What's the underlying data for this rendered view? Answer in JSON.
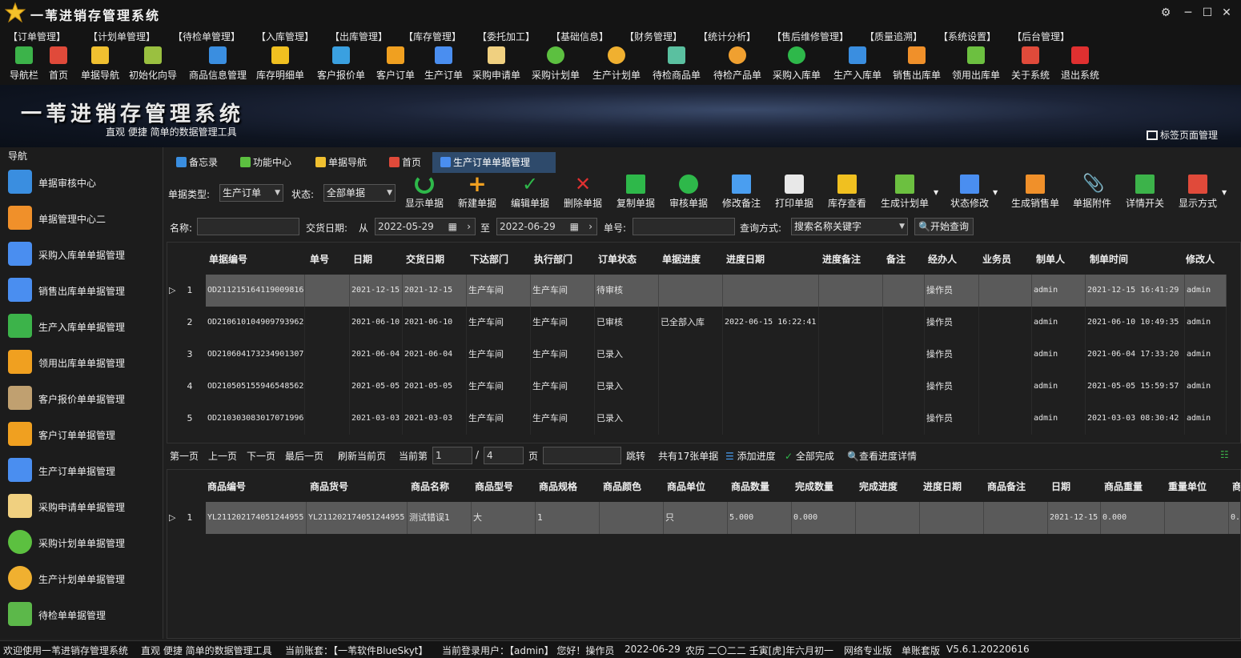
{
  "app": {
    "title": "一苇进销存管理系统"
  },
  "menu": [
    "【订单管理】",
    "【计划单管理】",
    "【待检单管理】",
    "【入库管理】",
    "【出库管理】",
    "【库存管理】",
    "【委托加工】",
    "【基础信息】",
    "【财务管理】",
    "【统计分析】",
    "【售后维修管理】",
    "【质量追溯】",
    "【系统设置】",
    "【后台管理】"
  ],
  "toolbar": [
    {
      "label": "导航栏",
      "color": "#3cb34a",
      "icon": "menu-icon"
    },
    {
      "label": "首页",
      "color": "#e04a3a",
      "icon": "home-icon"
    },
    {
      "label": "单据导航",
      "color": "#f0c030",
      "icon": "pen-icon"
    },
    {
      "label": "初始化向导",
      "color": "#9ac040",
      "icon": "wand-icon"
    },
    {
      "label": "商品信息管理",
      "color": "#3a8ee0",
      "icon": "cubes-icon"
    },
    {
      "label": "库存明细单",
      "color": "#f0c020",
      "icon": "warning-icon"
    },
    {
      "label": "客户报价单",
      "color": "#3aa0e0",
      "icon": "tag-icon"
    },
    {
      "label": "客户订单",
      "color": "#f0a020",
      "icon": "doc-icon"
    },
    {
      "label": "生产订单",
      "color": "#4a8ef0",
      "icon": "doc-icon"
    },
    {
      "label": "采购申请单",
      "color": "#f0d080",
      "icon": "mail-icon"
    },
    {
      "label": "采购计划单",
      "color": "#5cc040",
      "icon": "chat-icon"
    },
    {
      "label": "生产计划单",
      "color": "#f0b030",
      "icon": "chat-icon"
    },
    {
      "label": "待检商品单",
      "color": "#5ac0a0",
      "icon": "flask-icon"
    },
    {
      "label": "待检产品单",
      "color": "#f0a030",
      "icon": "flask-icon"
    },
    {
      "label": "采购入库单",
      "color": "#2eb84a",
      "icon": "plus-icon"
    },
    {
      "label": "生产入库单",
      "color": "#3a8ee0",
      "icon": "cart-icon"
    },
    {
      "label": "销售出库单",
      "color": "#f0902a",
      "icon": "transfer-icon"
    },
    {
      "label": "领用出库单",
      "color": "#6cc040",
      "icon": "download-icon"
    },
    {
      "label": "关于系统",
      "color": "#e04a3a",
      "icon": "home-icon"
    },
    {
      "label": "退出系统",
      "color": "#e03030",
      "icon": "exit-icon"
    }
  ],
  "banner": {
    "title": "一苇进销存管理系统",
    "subtitle": "直观 便捷 简单的数据管理工具",
    "tab_manage": "标签页面管理"
  },
  "nav": {
    "title": "导航",
    "items": [
      {
        "label": "单据审核中心",
        "color": "#3a8ee0"
      },
      {
        "label": "单据管理中心二",
        "color": "#f0902a"
      },
      {
        "label": "采购入库单单据管理",
        "color": "#4a8ef0"
      },
      {
        "label": "销售出库单单据管理",
        "color": "#4a8ef0"
      },
      {
        "label": "生产入库单单据管理",
        "color": "#3cb34a"
      },
      {
        "label": "领用出库单单据管理",
        "color": "#f0a020"
      },
      {
        "label": "客户报价单单据管理",
        "color": "#c0a070"
      },
      {
        "label": "客户订单单据管理",
        "color": "#f0a020"
      },
      {
        "label": "生产订单单据管理",
        "color": "#4a8ef0"
      },
      {
        "label": "采购申请单单据管理",
        "color": "#f0d080"
      },
      {
        "label": "采购计划单单据管理",
        "color": "#5cc040"
      },
      {
        "label": "生产计划单单据管理",
        "color": "#f0b030"
      },
      {
        "label": "待检单单据管理",
        "color": "#5cb84a"
      }
    ]
  },
  "tabs": [
    {
      "label": "备忘录",
      "color": "#3a8ee0"
    },
    {
      "label": "功能中心",
      "color": "#5cc040"
    },
    {
      "label": "单据导航",
      "color": "#f0c030"
    },
    {
      "label": "首页",
      "color": "#e04a3a"
    },
    {
      "label": "生产订单单据管理",
      "color": "#4a8ef0"
    }
  ],
  "filter": {
    "type_label": "单据类型:",
    "type_value": "生产订单",
    "status_label": "状态:",
    "status_value": "全部单据",
    "actions": [
      {
        "label": "显示单据",
        "color": "#2eb84a"
      },
      {
        "label": "新建单据",
        "color": "#f0a020"
      },
      {
        "label": "编辑单据",
        "color": "#2eb84a"
      },
      {
        "label": "删除单据",
        "color": "#e03030"
      },
      {
        "label": "复制单据",
        "color": "#2eb84a"
      },
      {
        "label": "审核单据",
        "color": "#2eb84a"
      },
      {
        "label": "修改备注",
        "color": "#4a9ef0"
      },
      {
        "label": "打印单据",
        "color": "#e8e8e8"
      },
      {
        "label": "库存查看",
        "color": "#f0c020"
      },
      {
        "label": "生成计划单",
        "color": "#6cc040"
      },
      {
        "label": "状态修改",
        "color": "#4a8ef0"
      },
      {
        "label": "生成销售单",
        "color": "#f0902a"
      },
      {
        "label": "单据附件",
        "color": "#40c0a0"
      },
      {
        "label": "详情开关",
        "color": "#3cb34a"
      },
      {
        "label": "显示方式",
        "color": "#e04a3a"
      }
    ]
  },
  "search": {
    "name_label": "名称:",
    "name_value": "",
    "date_label": "交货日期:",
    "from_label": "从",
    "from_value": "2022-05-29",
    "to_label": "至",
    "to_value": "2022-06-29",
    "no_label": "单号:",
    "no_value": "",
    "mode_label": "查询方式:",
    "mode_value": "搜索名称关键字",
    "search_button": "开始查询"
  },
  "orders": {
    "columns": [
      "单据编号",
      "单号",
      "日期",
      "交货日期",
      "下达部门",
      "执行部门",
      "订单状态",
      "单据进度",
      "进度日期",
      "进度备注",
      "备注",
      "经办人",
      "业务员",
      "制单人",
      "制单时间",
      "修改人"
    ],
    "rows": [
      [
        "1",
        "OD211215164119009816",
        "",
        "2021-12-15",
        "2021-12-15",
        "生产车间",
        "生产车间",
        "待审核",
        "",
        "",
        "",
        "",
        "操作员",
        "",
        "admin",
        "2021-12-15 16:41:29",
        "admin"
      ],
      [
        "2",
        "OD210610104909793962",
        "",
        "2021-06-10",
        "2021-06-10",
        "生产车间",
        "生产车间",
        "已审核",
        "已全部入库",
        "2022-06-15 16:22:41",
        "",
        "",
        "操作员",
        "",
        "admin",
        "2021-06-10 10:49:35",
        "admin"
      ],
      [
        "3",
        "OD210604173234901307",
        "",
        "2021-06-04",
        "2021-06-04",
        "生产车间",
        "生产车间",
        "已录入",
        "",
        "",
        "",
        "",
        "操作员",
        "",
        "admin",
        "2021-06-04 17:33:20",
        "admin"
      ],
      [
        "4",
        "OD210505155946548562",
        "",
        "2021-05-05",
        "2021-05-05",
        "生产车间",
        "生产车间",
        "已录入",
        "",
        "",
        "",
        "",
        "操作员",
        "",
        "admin",
        "2021-05-05 15:59:57",
        "admin"
      ],
      [
        "5",
        "OD210303083017071996",
        "",
        "2021-03-03",
        "2021-03-03",
        "生产车间",
        "生产车间",
        "已录入",
        "",
        "",
        "",
        "",
        "操作员",
        "",
        "admin",
        "2021-03-03 08:30:42",
        "admin"
      ]
    ]
  },
  "pager": {
    "first": "第一页",
    "prev": "上一页",
    "next": "下一页",
    "last": "最后一页",
    "refresh": "刷新当前页",
    "current_label": "当前第",
    "current": "1",
    "sep": "/",
    "total": "4",
    "page_unit": "页",
    "jump": "跳转",
    "total_text": "共有17张单据",
    "add_progress": "添加进度",
    "all_done": "全部完成",
    "view_progress": "查看进度详情"
  },
  "items": {
    "columns": [
      "商品编号",
      "商品货号",
      "商品名称",
      "商品型号",
      "商品规格",
      "商品颜色",
      "商品单位",
      "商品数量",
      "完成数量",
      "完成进度",
      "进度日期",
      "商品备注",
      "日期",
      "商品重量",
      "重量单位",
      "商"
    ],
    "rows": [
      [
        "1",
        "YL211202174051244955",
        "YL211202174051244955",
        "测试错误1",
        "大",
        "1",
        "",
        "只",
        "5.000",
        "0.000",
        "",
        "",
        "",
        "2021-12-15",
        "0.000",
        "",
        "0."
      ]
    ]
  },
  "status": {
    "welcome": "欢迎使用一苇进销存管理系统",
    "slogan": "直观 便捷 简单的数据管理工具",
    "account": "当前账套：【一苇软件BlueSkyt】",
    "user": "当前登录用户：【admin】 您好！操作员",
    "date": "2022-06-29",
    "lunar": "农历 二〇二二 壬寅[虎]年六月初一",
    "edition": "网络专业版",
    "mode": "单账套版",
    "version": "V5.6.1.20220616"
  }
}
